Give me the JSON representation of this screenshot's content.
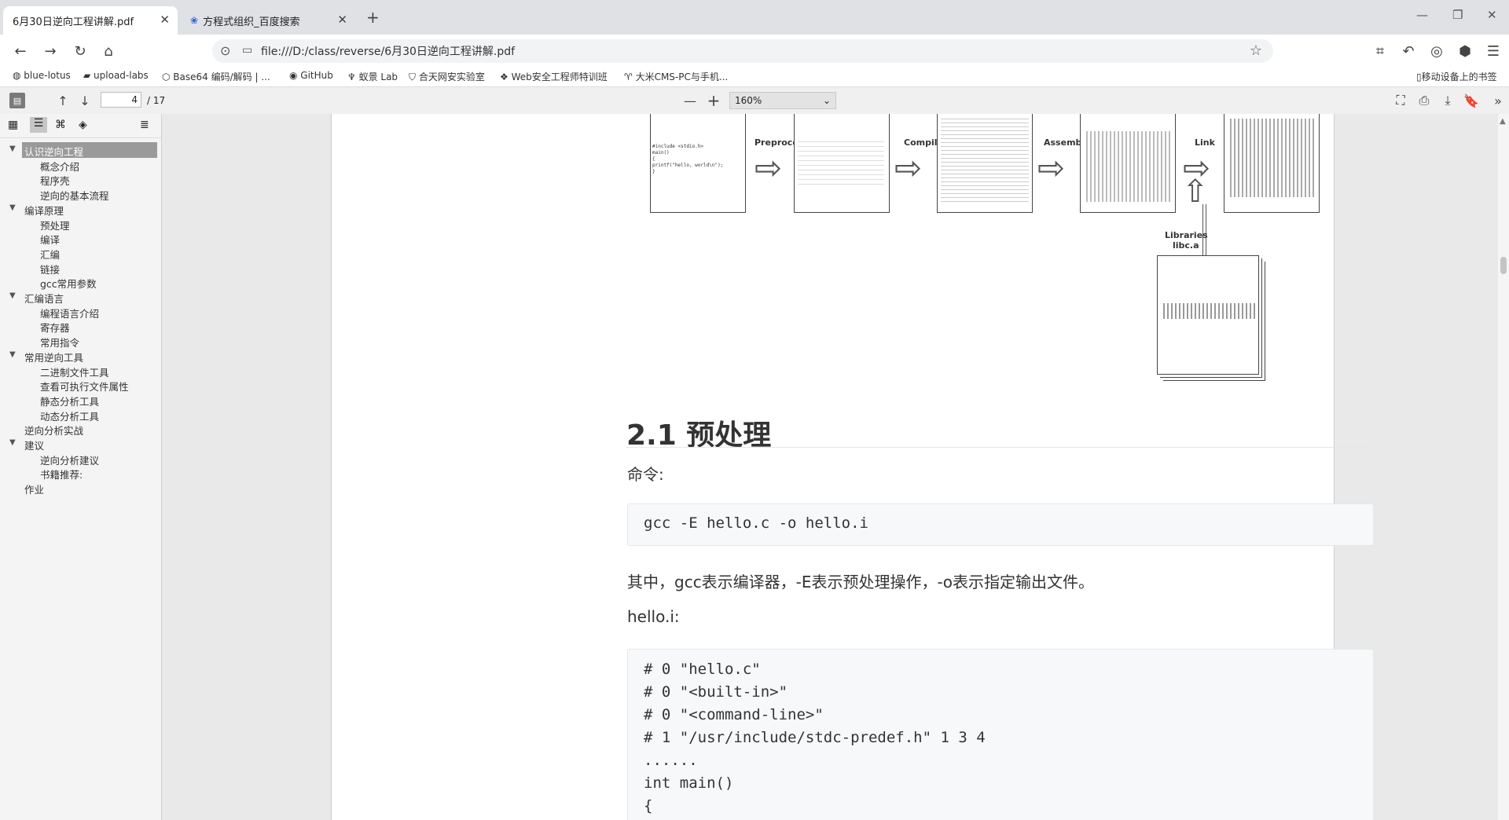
{
  "tabs": [
    {
      "title": "6月30日逆向工程讲解.pdf",
      "active": true
    },
    {
      "title": "方程式组织_百度搜索",
      "active": false
    }
  ],
  "new_tab_label": "+",
  "window_controls": [
    "—",
    "❐",
    "✕"
  ],
  "address": {
    "url": "file:///D:/class/reverse/6月30日逆向工程讲解.pdf"
  },
  "bookmarks": [
    "blue-lotus",
    "upload-labs",
    "Base64 编码/解码 | ...",
    "GitHub",
    "蚁景 Lab",
    "合天网安实验室",
    "Web安全工程师特训班",
    "大米CMS-PC与手机..."
  ],
  "mobile_bookmarks": "移动设备上的书签",
  "pdf_toolbar": {
    "page": "4",
    "total": "/ 17",
    "zoom": "160%",
    "minus": "—",
    "plus": "+"
  },
  "outline": [
    {
      "label": "认识逆向工程",
      "level": 0,
      "expanded": true,
      "selected": true
    },
    {
      "label": "概念介绍",
      "level": 1
    },
    {
      "label": "程序壳",
      "level": 1
    },
    {
      "label": "逆向的基本流程",
      "level": 1
    },
    {
      "label": "编译原理",
      "level": 0,
      "expanded": true
    },
    {
      "label": "预处理",
      "level": 1
    },
    {
      "label": "编译",
      "level": 1
    },
    {
      "label": "汇编",
      "level": 1
    },
    {
      "label": "链接",
      "level": 1
    },
    {
      "label": "gcc常用参数",
      "level": 1
    },
    {
      "label": "汇编语言",
      "level": 0,
      "expanded": true
    },
    {
      "label": "编程语言介绍",
      "level": 1
    },
    {
      "label": "寄存器",
      "level": 1
    },
    {
      "label": "常用指令",
      "level": 1
    },
    {
      "label": "常用逆向工具",
      "level": 0,
      "expanded": true
    },
    {
      "label": "二进制文件工具",
      "level": 1
    },
    {
      "label": "查看可执行文件属性",
      "level": 1
    },
    {
      "label": "静态分析工具",
      "level": 1
    },
    {
      "label": "动态分析工具",
      "level": 1
    },
    {
      "label": "逆向分析实战",
      "level": 0
    },
    {
      "label": "建议",
      "level": 0,
      "expanded": true
    },
    {
      "label": "逆向分析建议",
      "level": 1
    },
    {
      "label": "书籍推荐:",
      "level": 1
    },
    {
      "label": "作业",
      "level": 0
    }
  ],
  "figure": {
    "labels": {
      "preprocess": "Preprocess",
      "compile": "Compile",
      "assemble": "Assemble",
      "link": "Link",
      "libraries": "Libraries",
      "libc": "libc.a"
    },
    "source_lines": [
      "#include <stdio.h>",
      "main()",
      "{",
      "    printf(\"hello, world\\n\");",
      "}"
    ]
  },
  "section": {
    "heading": "2.1 预处理",
    "command_label": "命令:",
    "command": "gcc -E hello.c -o hello.i",
    "explanation": "其中，gcc表示编译器，-E表示预处理操作，-o表示指定输出文件。",
    "output_label": "hello.i:",
    "output_code": [
      "# 0 \"hello.c\"",
      "# 0 \"<built-in>\"",
      "# 0 \"<command-line>\"",
      "# 1 \"/usr/include/stdc-predef.h\" 1 3 4",
      "......",
      "int main()",
      "{"
    ]
  }
}
